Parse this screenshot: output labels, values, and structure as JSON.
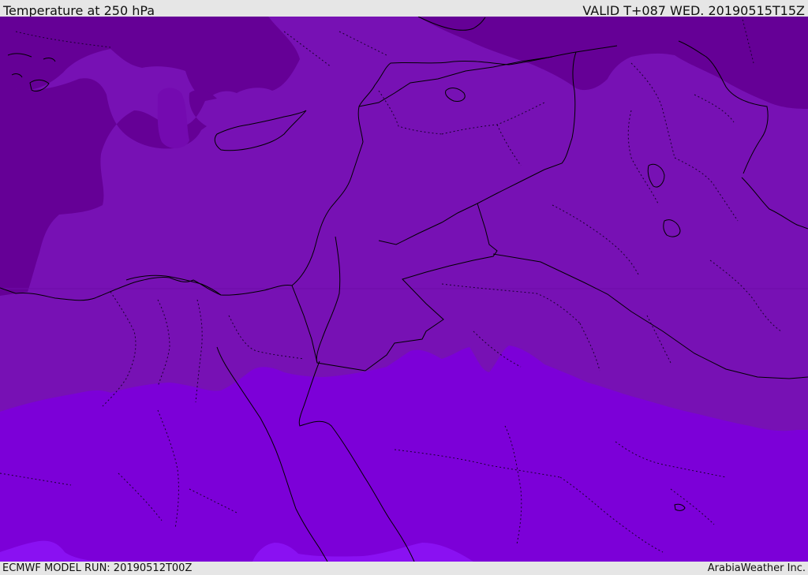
{
  "header": {
    "title": "Temperature at 250 hPa",
    "valid": "VALID T+087 WED. 20190515T15Z"
  },
  "footer": {
    "model_run": "ECMWF MODEL RUN: 20190512T00Z",
    "credit": "ArabiaWeather Inc."
  },
  "colors": {
    "band_coldest": "#650096",
    "band_cold": "#740ab0",
    "band_mid": "#7711b4",
    "band_warm": "#7c00d8",
    "band_warmest": "#8a11f2",
    "coast_line": "#000000",
    "bar_background": "#e6e6e6"
  }
}
